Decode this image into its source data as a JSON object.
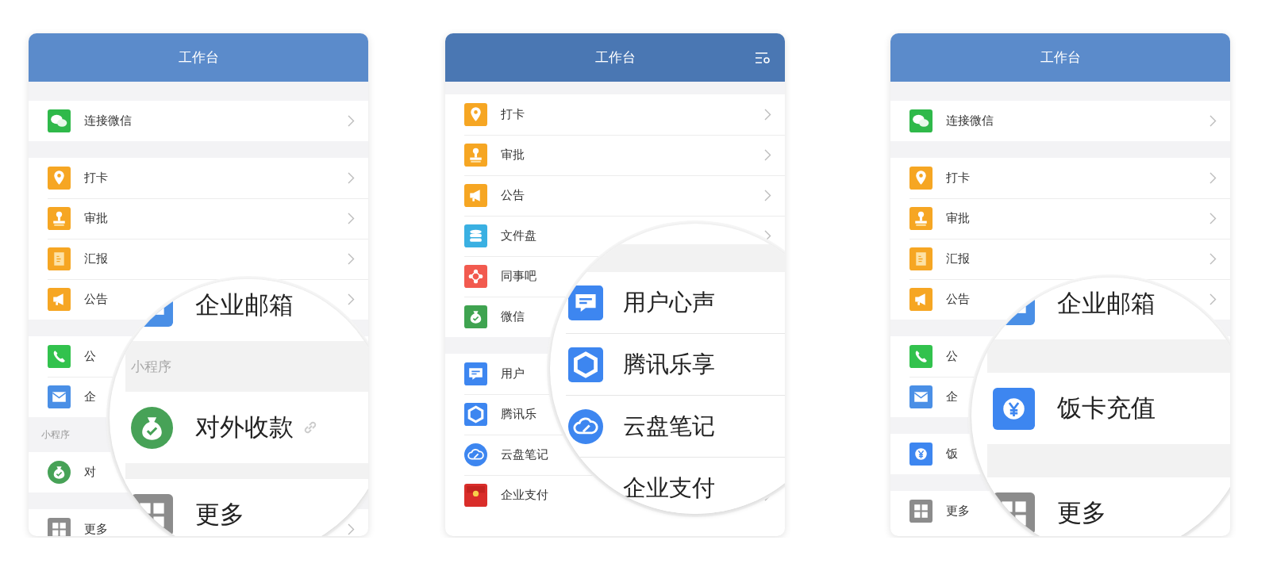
{
  "cards": [
    {
      "title": "工作台",
      "settings_icon": false,
      "items": [
        {
          "kind": "gap"
        },
        {
          "kind": "row",
          "label": "连接微信",
          "chevron": true
        },
        {
          "kind": "gap"
        },
        {
          "kind": "row",
          "label": "打卡",
          "chevron": true
        },
        {
          "kind": "row",
          "label": "审批",
          "chevron": true
        },
        {
          "kind": "row",
          "label": "汇报",
          "chevron": true
        },
        {
          "kind": "row",
          "label": "公告",
          "chevron": true
        },
        {
          "kind": "gap"
        },
        {
          "kind": "row",
          "label": "公",
          "chevron": false
        },
        {
          "kind": "row",
          "label": "企",
          "chevron": false
        },
        {
          "kind": "section",
          "label": "小程序"
        },
        {
          "kind": "row",
          "label": "对",
          "chevron": false
        },
        {
          "kind": "gap"
        },
        {
          "kind": "row",
          "label": "更多",
          "chevron": true
        }
      ],
      "magnifier": [
        {
          "kind": "row",
          "label": "企业邮箱",
          "link": false
        },
        {
          "kind": "section",
          "label": "小程序"
        },
        {
          "kind": "row",
          "label": "对外收款",
          "link": true
        },
        {
          "kind": "gap"
        },
        {
          "kind": "row",
          "label": "更多",
          "link": false
        }
      ]
    },
    {
      "title": "工作台",
      "settings_icon": true,
      "items": [
        {
          "kind": "gap"
        },
        {
          "kind": "row",
          "label": "打卡",
          "chevron": true
        },
        {
          "kind": "row",
          "label": "审批",
          "chevron": true
        },
        {
          "kind": "row",
          "label": "公告",
          "chevron": true
        },
        {
          "kind": "row",
          "label": "文件盘",
          "chevron": true
        },
        {
          "kind": "row",
          "label": "同事吧",
          "chevron": false
        },
        {
          "kind": "row",
          "label": "微信",
          "chevron": false
        },
        {
          "kind": "gap"
        },
        {
          "kind": "row",
          "label": "用户",
          "chevron": false
        },
        {
          "kind": "row",
          "label": "腾讯乐",
          "chevron": false
        },
        {
          "kind": "row",
          "label": "云盘笔记",
          "chevron": false
        },
        {
          "kind": "row",
          "label": "企业支付",
          "chevron": true
        }
      ],
      "magnifier": [
        {
          "kind": "gap"
        },
        {
          "kind": "row",
          "label": "用户心声",
          "link": false
        },
        {
          "kind": "row",
          "label": "腾讯乐享",
          "link": false
        },
        {
          "kind": "row",
          "label": "云盘笔记",
          "link": false
        },
        {
          "kind": "row",
          "label": "企业支付",
          "link": false
        }
      ]
    },
    {
      "title": "工作台",
      "settings_icon": false,
      "items": [
        {
          "kind": "gap"
        },
        {
          "kind": "row",
          "label": "连接微信",
          "chevron": true
        },
        {
          "kind": "gap"
        },
        {
          "kind": "row",
          "label": "打卡",
          "chevron": true
        },
        {
          "kind": "row",
          "label": "审批",
          "chevron": true
        },
        {
          "kind": "row",
          "label": "汇报",
          "chevron": true
        },
        {
          "kind": "row",
          "label": "公告",
          "chevron": true
        },
        {
          "kind": "gap"
        },
        {
          "kind": "row",
          "label": "公",
          "chevron": false
        },
        {
          "kind": "row",
          "label": "企",
          "chevron": false
        },
        {
          "kind": "gap"
        },
        {
          "kind": "row",
          "label": "饭",
          "chevron": false
        },
        {
          "kind": "gap"
        },
        {
          "kind": "row",
          "label": "更多",
          "chevron": false
        }
      ],
      "magnifier": [
        {
          "kind": "row",
          "label": "企业邮箱",
          "link": false
        },
        {
          "kind": "gap"
        },
        {
          "kind": "row",
          "label": "饭卡充值",
          "link": false
        },
        {
          "kind": "gap"
        },
        {
          "kind": "row",
          "label": "更多",
          "link": false
        }
      ]
    }
  ]
}
